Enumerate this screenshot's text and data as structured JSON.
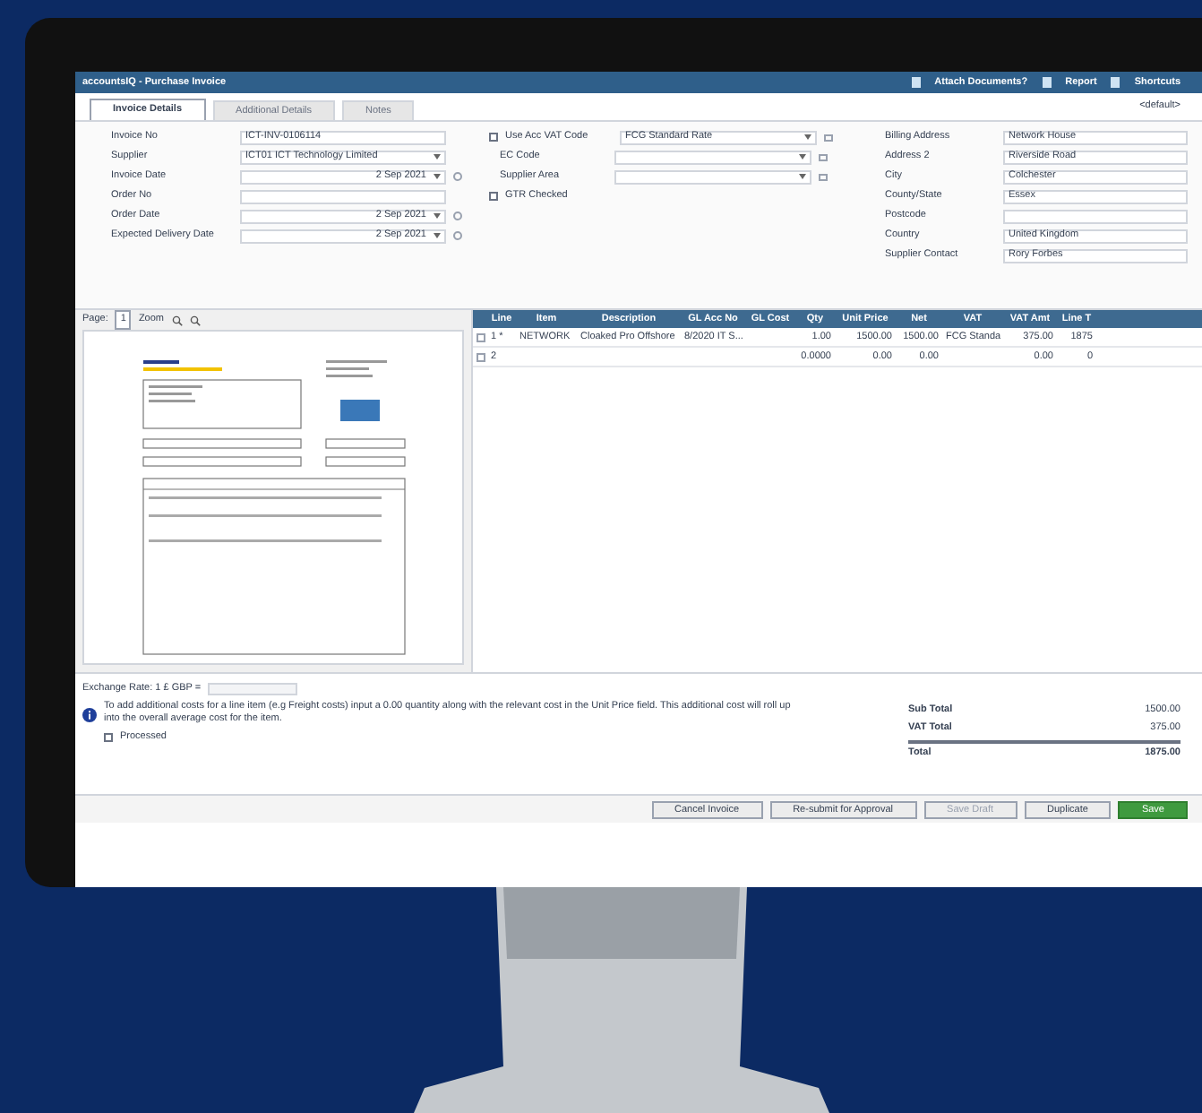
{
  "window": {
    "title": "accountsIQ - Purchase Invoice"
  },
  "header_actions": [
    {
      "label": "Attach Documents?"
    },
    {
      "label": "Report"
    },
    {
      "label": "Shortcuts"
    }
  ],
  "tabs": [
    {
      "label": "Invoice Details",
      "selected": true
    },
    {
      "label": "Additional Details",
      "selected": false
    },
    {
      "label": "Notes",
      "selected": false
    }
  ],
  "layout_selector": "<default>",
  "form_left": [
    {
      "label": "Invoice No",
      "value": "ICT-INV-0106114",
      "kind": "text"
    },
    {
      "label": "Supplier",
      "value": "ICT01 ICT Technology Limited",
      "kind": "select"
    },
    {
      "label": "Invoice Date",
      "value": "2 Sep 2021",
      "kind": "date"
    },
    {
      "label": "Order No",
      "kind": "text"
    },
    {
      "label": "Order Date",
      "value": "2 Sep 2021",
      "kind": "date"
    },
    {
      "label": "Expected Delivery Date",
      "value": "2 Sep 2021",
      "kind": "date"
    }
  ],
  "form_middle": [
    {
      "label": "Use Acc VAT Code",
      "checked": false,
      "value": "FCG Standard Rate"
    },
    {
      "label": "EC Code"
    },
    {
      "label": "Supplier Area"
    },
    {
      "label": "GTR Checked",
      "checked": false
    }
  ],
  "form_right": [
    {
      "label": "Billing Address",
      "value": "Network House"
    },
    {
      "label": "Address 2",
      "value": "Riverside Road"
    },
    {
      "label": "City",
      "value": "Colchester"
    },
    {
      "label": "County/State",
      "value": "Essex"
    },
    {
      "label": "Postcode"
    },
    {
      "label": "Country",
      "value": "United Kingdom"
    },
    {
      "label": "Supplier Contact",
      "value": "Rory Forbes"
    }
  ],
  "viewer": {
    "page_label": "Page:",
    "page": "1",
    "zoom_label": "Zoom"
  },
  "table": {
    "columns": [
      "Line",
      "Item",
      "Description",
      "GL Acc No",
      "GL Cost",
      "Qty",
      "Unit Price",
      "Net",
      "VAT",
      "VAT Amt",
      "Line T"
    ],
    "rows": [
      {
        "checked": false,
        "cells": [
          "1 *",
          "NETWORK",
          "Cloaked Pro Offshore",
          "8/2020 IT S...",
          "",
          "1.00",
          "1500.00",
          "1500.00",
          "FCG Standa",
          "375.00",
          "1875"
        ]
      },
      {
        "checked": false,
        "cells": [
          "2",
          "",
          "",
          "",
          "",
          "0.0000",
          "0.00",
          "0.00",
          "",
          "0.00",
          "0"
        ]
      }
    ]
  },
  "exchange_rate": {
    "label": "Exchange Rate: 1 £ GBP ="
  },
  "info_text": "To add additional costs for a line item (e.g Freight costs) input a 0.00 quantity along with the relevant cost in the Unit Price field. This additional cost will roll up into the overall average cost for the item.",
  "processed": {
    "label": "Processed",
    "checked": false
  },
  "totals": [
    {
      "label": "Sub Total",
      "value": "1500.00",
      "kind": "sub"
    },
    {
      "label": "VAT Total",
      "value": "375.00",
      "kind": "sub"
    },
    {
      "label": "Total",
      "value": "1875.00",
      "kind": "grand"
    }
  ],
  "buttons": [
    {
      "label": "Cancel Invoice",
      "kind": "plain",
      "disabled": false
    },
    {
      "label": "Re-submit for Approval",
      "kind": "plain",
      "disabled": false
    },
    {
      "label": "Save Draft",
      "kind": "plain",
      "disabled": true
    },
    {
      "label": "Duplicate",
      "kind": "plain",
      "disabled": false
    },
    {
      "label": "Save",
      "kind": "primary",
      "disabled": false
    }
  ]
}
